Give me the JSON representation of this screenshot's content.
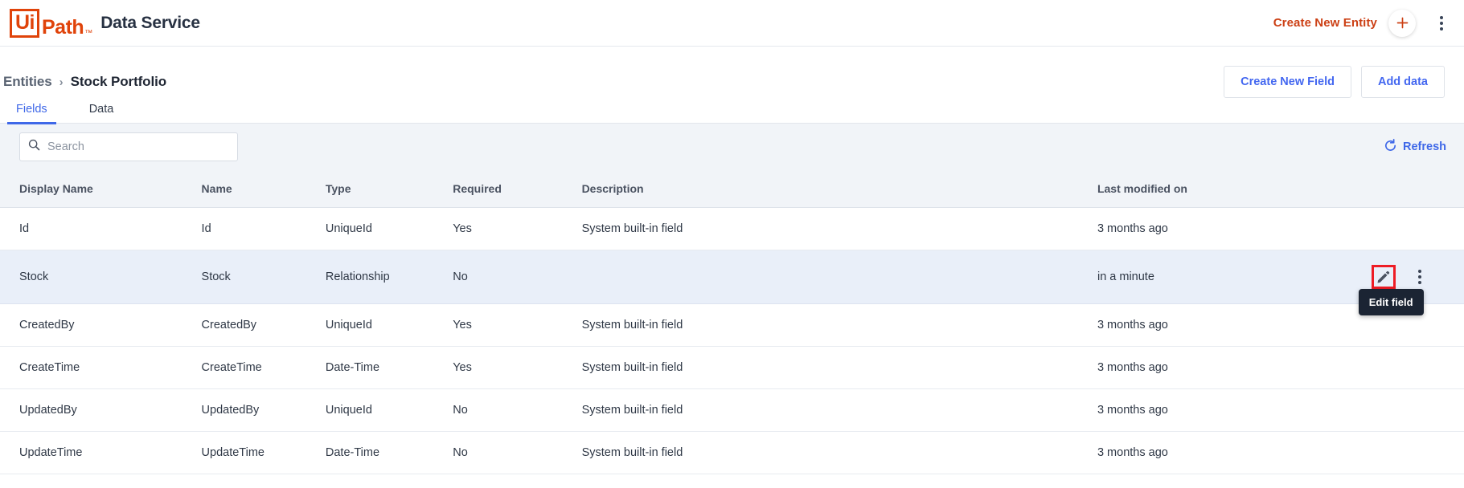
{
  "appbar": {
    "logo_ui": "Ui",
    "logo_path": "Path",
    "logo_tm": "™",
    "product_title": "Data Service",
    "create_entity_label": "Create New Entity",
    "plus_icon": "plus-icon",
    "overflow_icon": "kebab-menu-icon",
    "accent_color": "#cc4015"
  },
  "breadcrumb": {
    "parent": "Entities",
    "separator": "›",
    "current": "Stock Portfolio"
  },
  "actions": {
    "create_new_field": "Create New Field",
    "add_data": "Add data",
    "link_color": "#4367f0"
  },
  "tabs": [
    {
      "label": "Fields",
      "active": true
    },
    {
      "label": "Data",
      "active": false
    }
  ],
  "toolbar": {
    "search_placeholder": "Search",
    "search_value": "",
    "search_icon": "search-icon",
    "refresh_label": "Refresh",
    "refresh_icon": "refresh-icon",
    "background": "#f1f4f8"
  },
  "table": {
    "columns": [
      "Display Name",
      "Name",
      "Type",
      "Required",
      "Description",
      "Last modified on"
    ],
    "rows": [
      {
        "display_name": "Id",
        "name": "Id",
        "type": "UniqueId",
        "required": "Yes",
        "description": "System built-in field",
        "last_modified": "3 months ago",
        "highlighted": false
      },
      {
        "display_name": "Stock",
        "name": "Stock",
        "type": "Relationship",
        "required": "No",
        "description": "",
        "last_modified": "in a minute",
        "highlighted": true
      },
      {
        "display_name": "CreatedBy",
        "name": "CreatedBy",
        "type": "UniqueId",
        "required": "Yes",
        "description": "System built-in field",
        "last_modified": "3 months ago",
        "highlighted": false
      },
      {
        "display_name": "CreateTime",
        "name": "CreateTime",
        "type": "Date-Time",
        "required": "Yes",
        "description": "System built-in field",
        "last_modified": "3 months ago",
        "highlighted": false
      },
      {
        "display_name": "UpdatedBy",
        "name": "UpdatedBy",
        "type": "UniqueId",
        "required": "No",
        "description": "System built-in field",
        "last_modified": "3 months ago",
        "highlighted": false
      },
      {
        "display_name": "UpdateTime",
        "name": "UpdateTime",
        "type": "Date-Time",
        "required": "No",
        "description": "System built-in field",
        "last_modified": "3 months ago",
        "highlighted": false
      }
    ]
  },
  "row_actions": {
    "edit_icon": "pencil-edit-icon",
    "more_icon": "kebab-menu-icon",
    "tooltip_text": "Edit field",
    "highlight_border_color": "#ee1c25"
  }
}
